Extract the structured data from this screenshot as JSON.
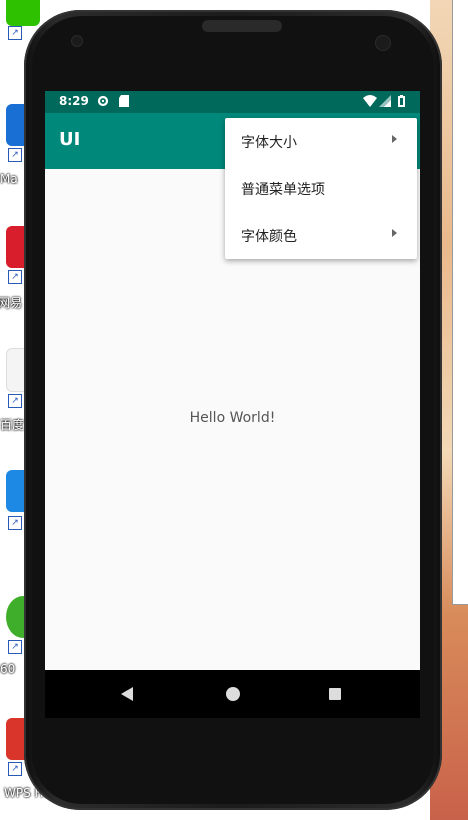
{
  "desktop": {
    "labels": [
      "Ma",
      "网易",
      "百度",
      "60",
      "WPS Hc"
    ]
  },
  "status_bar": {
    "time": "8:29"
  },
  "app_bar": {
    "title": "UI"
  },
  "overflow_menu": {
    "items": [
      {
        "label": "字体大小",
        "has_submenu": true
      },
      {
        "label": "普通菜单选项",
        "has_submenu": false
      },
      {
        "label": "字体颜色",
        "has_submenu": true
      }
    ]
  },
  "content": {
    "text": "Hello World!"
  },
  "colors": {
    "status_bar": "#00695c",
    "app_bar": "#00897b",
    "screen_bg": "#fafafa",
    "nav_bar": "#000000"
  }
}
